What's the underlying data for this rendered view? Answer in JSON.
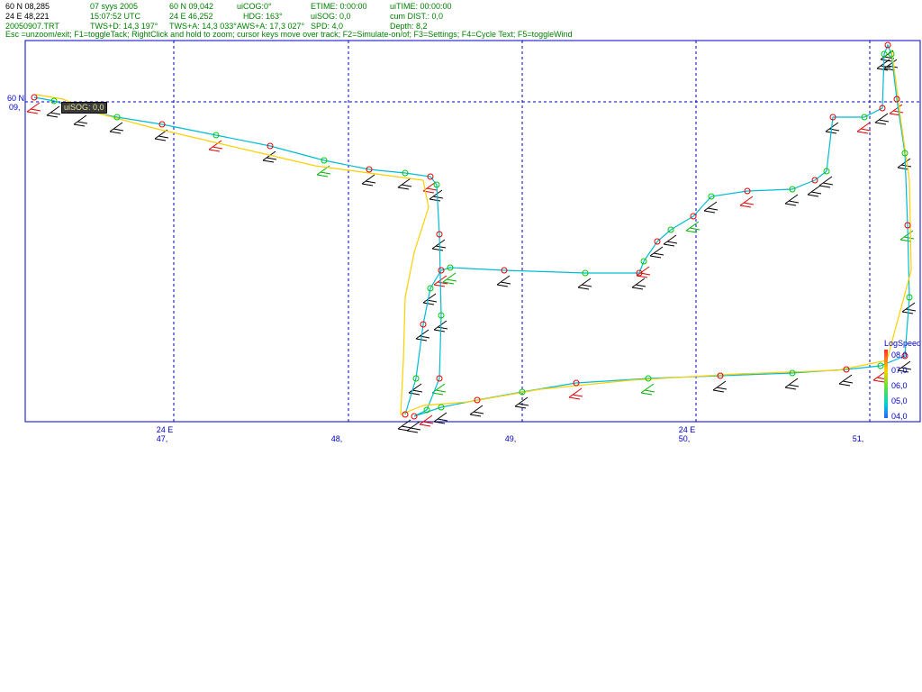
{
  "header": {
    "row1": {
      "c1": "60 N 08,285",
      "c2": "07 syys 2005",
      "c3": "60 N 09,042",
      "c4": "uiCOG:0°",
      "c5": "ETIME: 0:00:00",
      "c6": "uiTIME: 00:00:00"
    },
    "row2": {
      "c1": "24 E 48,221",
      "c2": "15:07:52  UTC",
      "c3": "24 E 46,252",
      "c4": "HDG: 163°",
      "c5": "uiSOG: 0,0",
      "c6": "cum DIST.: 0,0"
    },
    "row3": {
      "c1": "20050907.TRT",
      "c2": "TWS+D: 14,3 197°",
      "c3": "TWS+A: 14,3 033°",
      "c4": "AWS+A: 17,3 027°",
      "c5": "SPD: 4,0",
      "c6": "Depth: 8,2"
    },
    "help": "Esc =unzoom/exit; F1=toggleTack; RightClick and hold to zoom; cursor keys move over track; F2=Simulate-on/of; F3=Settings; F4=Cycle Text; F5=toggleWind"
  },
  "map": {
    "y_label_line1": "60 N",
    "y_label_line2": "09,",
    "x_labels": [
      {
        "deg": "24 E",
        "min": "47,"
      },
      {
        "deg": "",
        "min": "48,"
      },
      {
        "deg": "",
        "min": "49,"
      },
      {
        "deg": "24 E",
        "min": "50,"
      },
      {
        "deg": "",
        "min": "51,"
      }
    ],
    "cursor_badge": "uiSOG: 0,0",
    "colors": {
      "frame": "#0000c8",
      "grid": "#0000c8",
      "track_low": "#00bcd4",
      "track_high": "#ffd000",
      "marker_green": "#00c800",
      "marker_red": "#e00000",
      "wind_black": "#000000"
    }
  },
  "legend": {
    "title": "LogSpeed",
    "ticks": [
      "08,0",
      "07,0",
      "06,0",
      "05,0",
      "04,0"
    ]
  }
}
